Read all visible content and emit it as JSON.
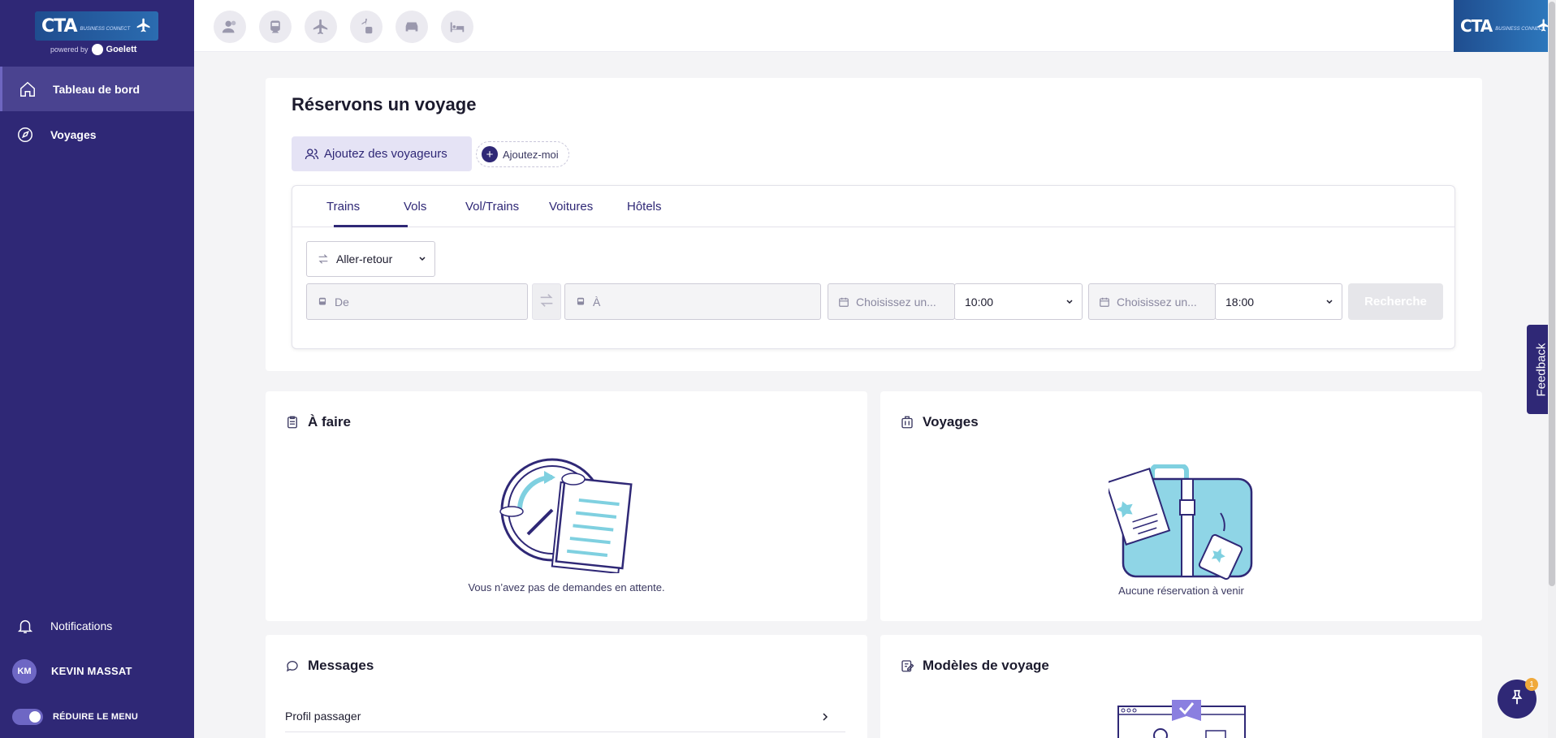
{
  "brand": {
    "logo_text": "CTA",
    "logo_sub": "BUSINESS CONNECT",
    "powered_by": "powered by",
    "powered_brand": "Goelett"
  },
  "sidebar": {
    "items": [
      {
        "label": "Tableau de bord",
        "icon": "home-icon",
        "active": true
      },
      {
        "label": "Voyages",
        "icon": "compass-icon",
        "active": false
      }
    ],
    "bottom": {
      "notifications": "Notifications",
      "user_initials": "KM",
      "user_name": "KEVIN MASSAT",
      "collapse_label": "RÉDUIRE LE MENU"
    }
  },
  "topbar": {
    "icons": [
      "travellers-icon",
      "train-icon",
      "plane-icon",
      "flight-train-icon",
      "car-icon",
      "hotel-icon"
    ]
  },
  "booking": {
    "title": "Réservons un voyage",
    "add_travellers": "Ajoutez des voyageurs",
    "add_me": "Ajoutez-moi",
    "tabs": [
      "Trains",
      "Vols",
      "Vol/Trains",
      "Voitures",
      "Hôtels"
    ],
    "active_tab": "Trains",
    "trip_type": "Aller-retour",
    "from_placeholder": "De",
    "to_placeholder": "À",
    "depart_date_placeholder": "Choisissez un...",
    "depart_time": "10:00",
    "return_date_placeholder": "Choisissez un...",
    "return_time": "18:00",
    "search_button": "Recherche"
  },
  "todo": {
    "title": "À faire",
    "empty_text": "Vous n’avez pas de demandes en attente."
  },
  "trips": {
    "title": "Voyages",
    "empty_text": "Aucune réservation à venir"
  },
  "messages": {
    "title": "Messages",
    "rows": [
      "Profil passager"
    ]
  },
  "templates": {
    "title": "Modèles de voyage"
  },
  "feedback": {
    "label": "Feedback"
  },
  "pin": {
    "badge": "1"
  },
  "colors": {
    "sidebar": "#2f2876",
    "accent": "#2f2876",
    "illustration": "#7fd0e0"
  }
}
